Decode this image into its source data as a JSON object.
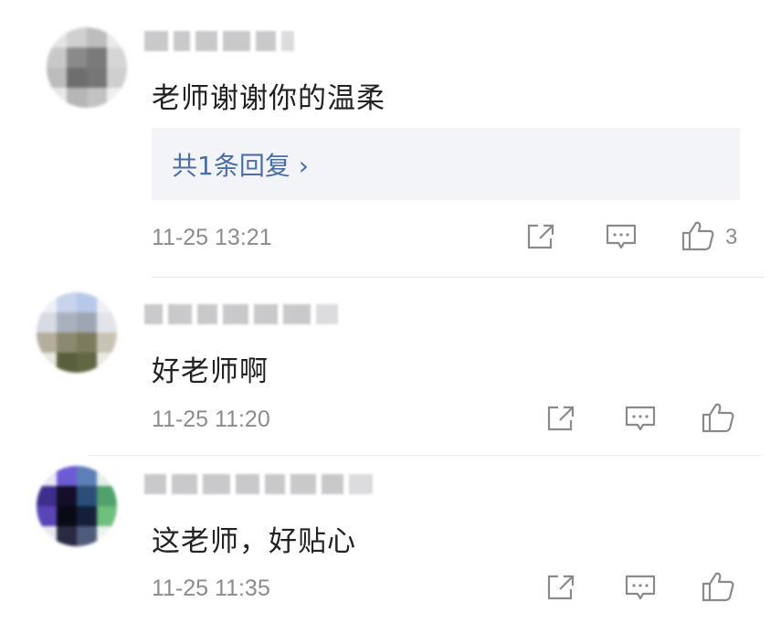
{
  "comments": [
    {
      "text": "老师谢谢你的温柔",
      "reply_label": "共1条回复 ›",
      "time": "11-25 13:21",
      "like_count": "3",
      "avatar_colors": [
        "#e4e4e4",
        "#d0d0d0",
        "#bdbdbd",
        "#eaeaea",
        "#c8c8c8",
        "#8a8a8a",
        "#7a7a7a",
        "#d6d6d6",
        "#bcbcbc",
        "#6e6e6e",
        "#767676",
        "#cfcfcf",
        "#e8e8e8",
        "#b6b6b6",
        "#c2c2c2",
        "#efefef"
      ]
    },
    {
      "text": "好老师啊",
      "time": "11-25 11:20",
      "like_count": "",
      "avatar_colors": [
        "#eef0f5",
        "#c7d4ec",
        "#b6c9ea",
        "#eef0f5",
        "#d9dbe3",
        "#a9b1bd",
        "#9ea6b3",
        "#e2e4ea",
        "#b4ae9d",
        "#8c8a6e",
        "#7d7b5e",
        "#c8c4b4",
        "#e9e7e0",
        "#5a5e3c",
        "#626642",
        "#ebe9e2"
      ]
    },
    {
      "text": "这老师，好贴心",
      "time": "11-25 11:35",
      "like_count": "",
      "avatar_colors": [
        "#e9e8f3",
        "#6d5bd3",
        "#5c7fb7",
        "#e6eee8",
        "#3e2e8c",
        "#140e28",
        "#2b4e78",
        "#4fa06a",
        "#5a44b8",
        "#0a0a14",
        "#14203a",
        "#6fbf7e",
        "#e8e8ef",
        "#2a2a44",
        "#505a7a",
        "#eef3ef"
      ]
    }
  ]
}
